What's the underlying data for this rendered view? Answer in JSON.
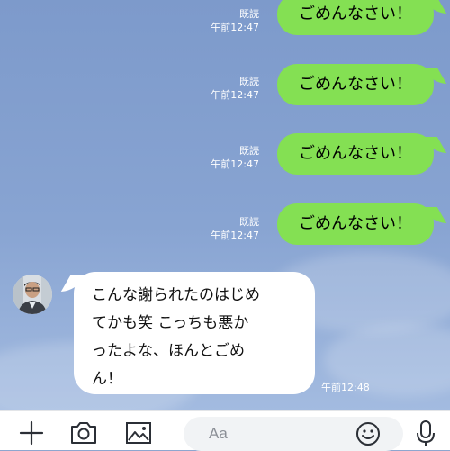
{
  "messages_out": [
    {
      "read": "既読",
      "time": "午前12:47",
      "text": "ごめんなさい！"
    },
    {
      "read": "既読",
      "time": "午前12:47",
      "text": "ごめんなさい！"
    },
    {
      "read": "既読",
      "time": "午前12:47",
      "text": "ごめんなさい！"
    },
    {
      "read": "既読",
      "time": "午前12:47",
      "text": "ごめんなさい！"
    }
  ],
  "message_in": {
    "text_lines": [
      "こんな謝られたのはじめ",
      "てかも笑 こっちも悪か",
      "ったよな、ほんとごめ",
      "ん！"
    ],
    "time": "午前12:48"
  },
  "toolbar": {
    "input_placeholder": "Aa",
    "icons": [
      "plus-icon",
      "camera-icon",
      "image-icon",
      "emoji-icon",
      "mic-icon"
    ]
  },
  "colors": {
    "bubble_out": "#84e053",
    "bubble_in": "#ffffff",
    "chat_background": "#7d9acb"
  }
}
